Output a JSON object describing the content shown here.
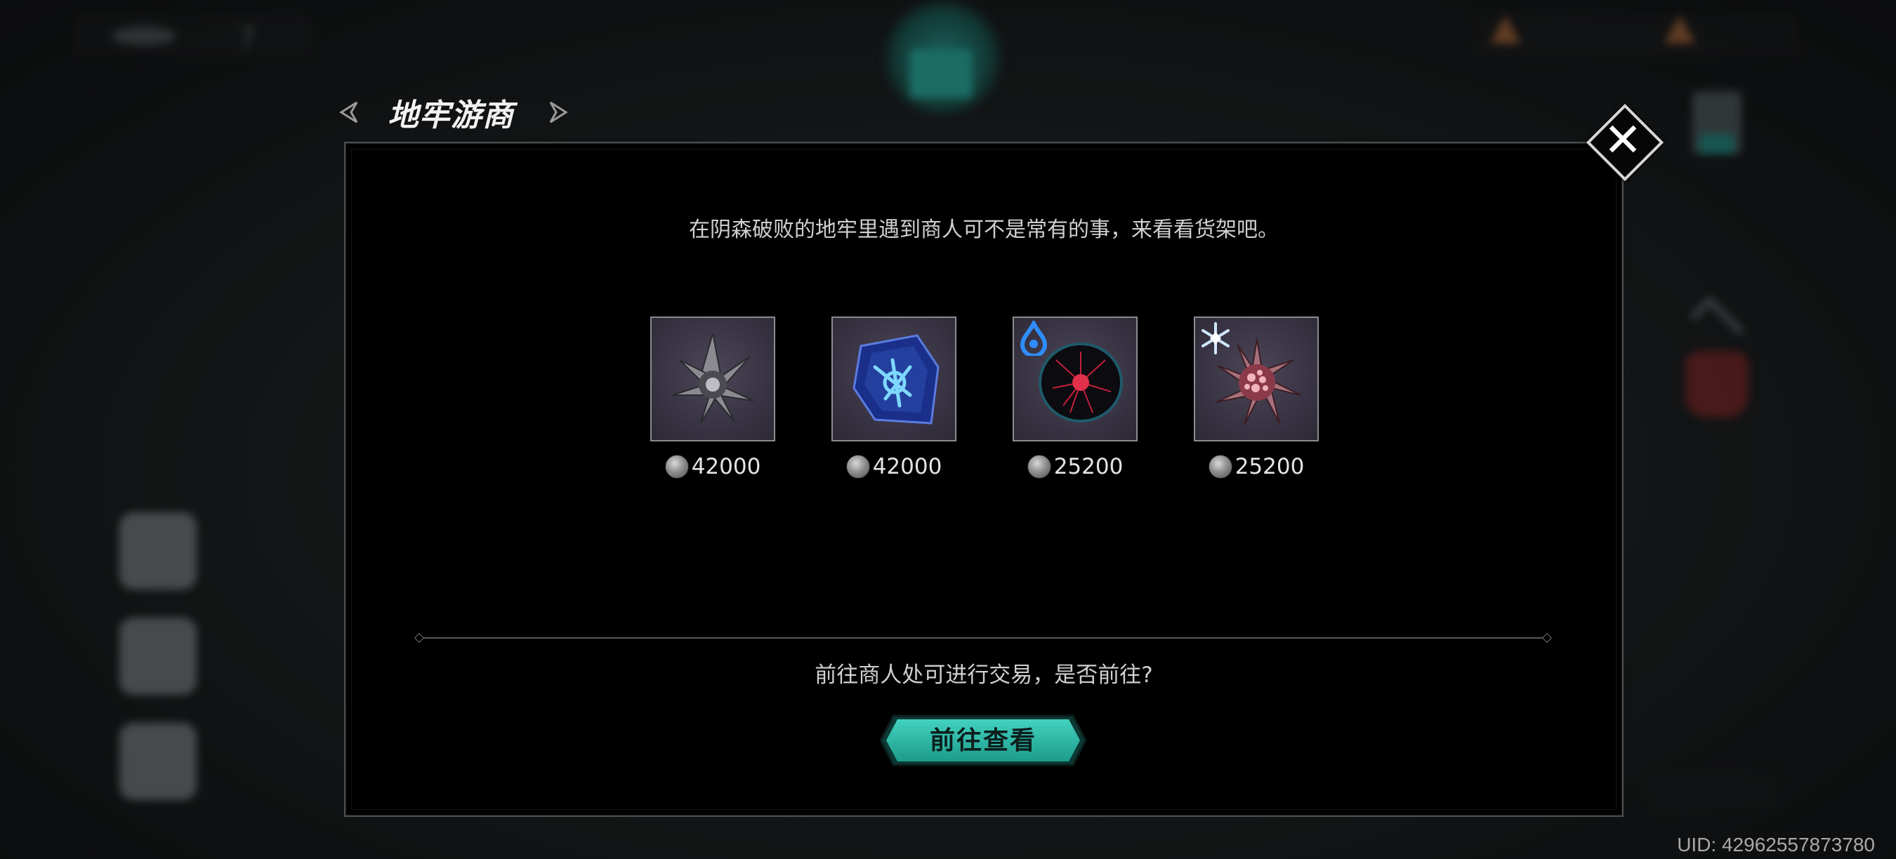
{
  "title": "地牢游商",
  "description": "在阴森破败的地牢里遇到商人可不是常有的事，来看看货架吧。",
  "items": [
    {
      "icon": "dark-crystal-cluster-icon",
      "price": "42000",
      "badge": null
    },
    {
      "icon": "blue-rune-stone-icon",
      "price": "42000",
      "badge": null
    },
    {
      "icon": "red-void-orb-icon",
      "price": "25200",
      "badge": "water-drop-icon"
    },
    {
      "icon": "pink-frost-crystal-icon",
      "price": "25200",
      "badge": "snowflake-icon"
    }
  ],
  "question": "前往商人处可进行交易，是否前往?",
  "go_button": "前往查看",
  "uid": "UID: 42962557873780",
  "colors": {
    "accent_teal": "#2fb9a6",
    "panel_bg": "#000000",
    "item_bg": "#3a3545"
  }
}
